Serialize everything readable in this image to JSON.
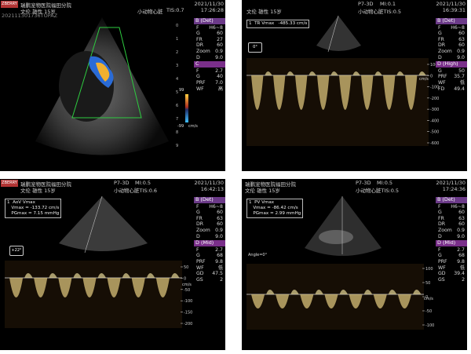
{
  "panels": [
    {
      "id": "p1",
      "brand": "ZBERRY",
      "hospital": "瑞鹏宠物医院福田分院",
      "patient": "文伦  雄性  15岁",
      "mode": "小动物心脏",
      "tis": "TIS:0.7",
      "date": "2021/11/30",
      "time": "17:26:28",
      "left_id": "202111301736TOPAZ",
      "b_section": "B (Det)",
      "b_params": [
        [
          "F",
          "H6~8"
        ],
        [
          "G",
          "60"
        ],
        [
          "FR",
          "27"
        ],
        [
          "DR",
          "60"
        ],
        [
          "Zoom",
          "0.9"
        ],
        [
          "D",
          "9.0"
        ]
      ],
      "c_section": "C",
      "c_params": [
        [
          "F",
          "2.7"
        ],
        [
          "G",
          "40"
        ],
        [
          "PRF",
          "7.0"
        ],
        [
          "WF",
          "高"
        ]
      ],
      "colorbar_top": "99",
      "colorbar_bottom": "-99",
      "colorbar_unit": "cm/s",
      "depth_marks": [
        "0",
        "1",
        "2",
        "3",
        "4",
        "5",
        "6",
        "7",
        "8",
        "9"
      ]
    },
    {
      "id": "p2",
      "hospital": "",
      "mode": "P7-3D",
      "mi": "MI:0.1",
      "date": "2021/11/30",
      "time": "16:39:31",
      "patient": "文伦  雄性  15岁",
      "tis": "小动物心脏TIS:0.5",
      "meas_lines": [
        "1  TR Vmax   -485.33 cm/s"
      ],
      "b_section": "B (Det)",
      "b_params": [
        [
          "F",
          "H6~8"
        ],
        [
          "G",
          "60"
        ],
        [
          "FR",
          "63"
        ],
        [
          "DR",
          "60"
        ],
        [
          "Zoom",
          "0.9"
        ],
        [
          "D",
          "9.0"
        ]
      ],
      "d_section": "D (High)",
      "d_params": [
        [
          "G",
          "50"
        ],
        [
          "PRF",
          "35.7"
        ],
        [
          "WF",
          "低"
        ],
        [
          "FD",
          "49.4"
        ]
      ],
      "axis_unit": "cm/s",
      "axis_ticks": [
        "100",
        "0",
        "-100",
        "-200",
        "-300",
        "-400",
        "-500",
        "-600"
      ],
      "probe_label": "0°"
    },
    {
      "id": "p3",
      "brand": "ZBERRY",
      "hospital": "瑞鹏宠物医院福田分院",
      "patient": "文伦  雄性  15岁",
      "mode": "P7-3D",
      "mi": "MI:0.5",
      "tis": "小动物心脏TIS:0.6",
      "date": "2021/11/30",
      "time": "16:42:13",
      "meas_lines": [
        "1  AoV Vmax",
        "   Vmax = -133.72 cm/s",
        "   PGmax = 7.15 mmHg"
      ],
      "b_section": "B (Det)",
      "b_params": [
        [
          "F",
          "H6~8"
        ],
        [
          "G",
          "60"
        ],
        [
          "FR",
          "63"
        ],
        [
          "DR",
          "60"
        ],
        [
          "Zoom",
          "0.9"
        ],
        [
          "D",
          "9.0"
        ]
      ],
      "d_section": "D (Mid)",
      "d_params": [
        [
          "F",
          "2.7"
        ],
        [
          "G",
          "68"
        ],
        [
          "PRF",
          "9.8"
        ],
        [
          "WF",
          "低"
        ],
        [
          "GD",
          "47.5"
        ],
        [
          "GS",
          "2"
        ]
      ],
      "axis_unit": "cm/s",
      "axis_ticks": [
        "50",
        "0",
        "-50",
        "-100",
        "-150",
        "-200"
      ],
      "probe_label": "+22°"
    },
    {
      "id": "p4",
      "hospital": "瑞鹏宠物医院福田分院",
      "patient": "文伦  雄性  15岁",
      "mode": "P7-3D",
      "mi": "MI:0.5",
      "tis": "小动物心脏TIS:0.5",
      "date": "2021/11/30",
      "time": "17:24:36",
      "meas_lines": [
        "1  PV Vmax",
        "   Vmax = -86.42 cm/s",
        "   PGmax = 2.99 mmHg"
      ],
      "b_section": "B (Det)",
      "b_params": [
        [
          "F",
          "H6~8"
        ],
        [
          "G",
          "60"
        ],
        [
          "FR",
          "63"
        ],
        [
          "DR",
          "60"
        ],
        [
          "Zoom",
          "0.9"
        ],
        [
          "D",
          "9.0"
        ]
      ],
      "d_section": "D (Mid)",
      "d_params": [
        [
          "F",
          "2.7"
        ],
        [
          "G",
          "68"
        ],
        [
          "PRF",
          "9.8"
        ],
        [
          "WF",
          "低"
        ],
        [
          "GD",
          "39.4"
        ],
        [
          "GS",
          "2"
        ]
      ],
      "axis_unit": "cm/s",
      "axis_ticks": [
        "100",
        "50",
        "0",
        "-50",
        "-100"
      ],
      "angle_label": "Angle=0°"
    }
  ],
  "colors": {
    "panel_bg": "#000000",
    "spectrum": "#d9c27a",
    "b_section": "#6b3a88",
    "sector_outline": "#2ecc40"
  }
}
